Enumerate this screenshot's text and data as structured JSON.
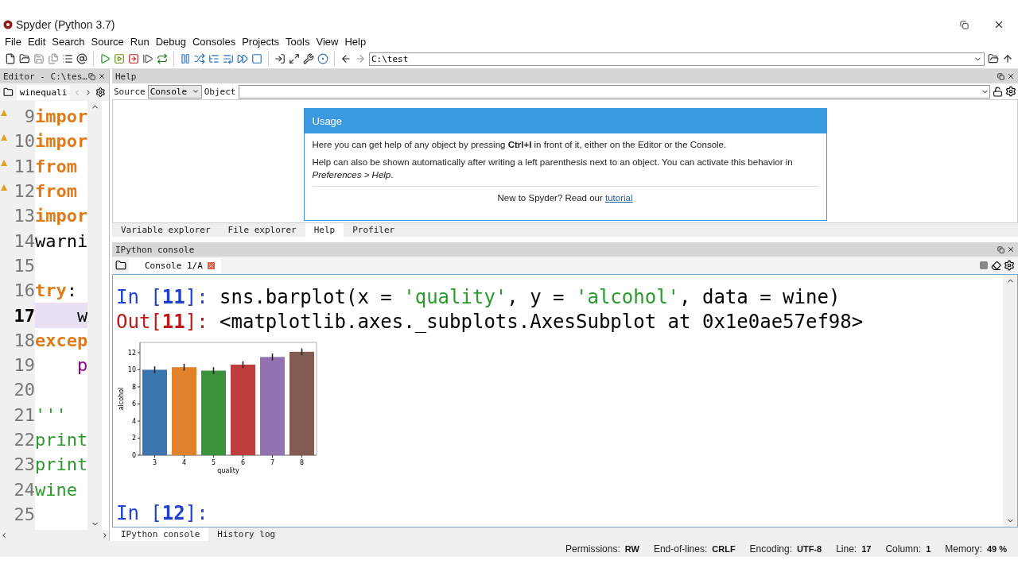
{
  "window": {
    "title": "Spyder (Python 3.7)"
  },
  "menu": [
    "File",
    "Edit",
    "Search",
    "Source",
    "Run",
    "Debug",
    "Consoles",
    "Projects",
    "Tools",
    "View",
    "Help"
  ],
  "toolbar": {
    "path": "C:\\test"
  },
  "editor": {
    "title": "Editor - C:\\tes…",
    "tab": "winequali",
    "lines": [
      {
        "number": "9",
        "warning": true,
        "current": false,
        "tokens": [
          {
            "text": "impor",
            "kind": "keyword"
          }
        ]
      },
      {
        "number": "10",
        "warning": true,
        "current": false,
        "tokens": [
          {
            "text": "impor",
            "kind": "keyword"
          }
        ]
      },
      {
        "number": "11",
        "warning": true,
        "current": false,
        "tokens": [
          {
            "text": "from",
            "kind": "keyword"
          }
        ]
      },
      {
        "number": "12",
        "warning": true,
        "current": false,
        "tokens": [
          {
            "text": "from",
            "kind": "keyword"
          }
        ]
      },
      {
        "number": "13",
        "warning": false,
        "current": false,
        "tokens": [
          {
            "text": "impor",
            "kind": "keyword"
          }
        ]
      },
      {
        "number": "14",
        "warning": false,
        "current": false,
        "tokens": [
          {
            "text": "warni",
            "kind": "plain"
          }
        ]
      },
      {
        "number": "15",
        "warning": false,
        "current": false
      },
      {
        "number": "16",
        "warning": false,
        "current": false,
        "tokens": [
          {
            "text": "try",
            "kind": "keyword"
          },
          {
            "text": ":",
            "kind": "plain"
          }
        ]
      },
      {
        "number": "17",
        "warning": false,
        "current": true,
        "tokens": [
          {
            "text": "    w",
            "kind": "plain"
          }
        ]
      },
      {
        "number": "18",
        "warning": false,
        "current": false,
        "tokens": [
          {
            "text": "excep",
            "kind": "keyword"
          }
        ]
      },
      {
        "number": "19",
        "warning": false,
        "current": false,
        "tokens": [
          {
            "text": "    p",
            "kind": "builtin"
          }
        ]
      },
      {
        "number": "20",
        "warning": false,
        "current": false
      },
      {
        "number": "21",
        "warning": false,
        "current": false,
        "tokens": [
          {
            "text": "'''",
            "kind": "string"
          }
        ]
      },
      {
        "number": "22",
        "warning": false,
        "current": false,
        "tokens": [
          {
            "text": "print",
            "kind": "string"
          }
        ]
      },
      {
        "number": "23",
        "warning": false,
        "current": false,
        "tokens": [
          {
            "text": "print",
            "kind": "string"
          }
        ]
      },
      {
        "number": "24",
        "warning": false,
        "current": false,
        "tokens": [
          {
            "text": "wine",
            "kind": "string"
          }
        ]
      },
      {
        "number": "25",
        "warning": false,
        "current": false
      }
    ]
  },
  "help": {
    "title": "Help",
    "source_label": "Source",
    "source_value": "Console",
    "object_label": "Object",
    "card": {
      "title": "Usage",
      "paragraphs": [
        "Here you can get help of any object by pressing **Ctrl+I** in front of it, either on the Editor or the Console.",
        "Help can also be shown automatically after writing a left parenthesis next to an object. You can activate this behavior in *Preferences > Help*."
      ],
      "footer": "New to Spyder? Read our ",
      "link": "tutorial"
    },
    "tabs": [
      {
        "label": "Variable explorer",
        "selected": false
      },
      {
        "label": "File explorer",
        "selected": false
      },
      {
        "label": "Help",
        "selected": true
      },
      {
        "label": "Profiler",
        "selected": false
      }
    ]
  },
  "console": {
    "title": "IPython console",
    "tab": "Console 1/A",
    "lines": [
      {
        "kind": "in",
        "prompt": "In [",
        "number": "11",
        "close": "]: ",
        "tokens": [
          {
            "text": "sns.barplot(x = ",
            "kind": "code"
          },
          {
            "text": "'quality'",
            "kind": "string"
          },
          {
            "text": ", y = ",
            "kind": "code"
          },
          {
            "text": "'alcohol'",
            "kind": "string"
          },
          {
            "text": ", data = wine)",
            "kind": "code"
          }
        ]
      },
      {
        "kind": "out",
        "prompt": "Out[",
        "number": "11",
        "close": "]: ",
        "tokens": [
          {
            "text": "<matplotlib.axes._subplots.AxesSubplot at 0x1e0ae57ef98>",
            "kind": "code"
          }
        ]
      }
    ],
    "chart_data": {
      "type": "bar",
      "xlabel": "quality",
      "ylabel": "alcohol",
      "categories": [
        "3",
        "4",
        "5",
        "6",
        "7",
        "8"
      ],
      "stacked": true,
      "series": [
        {
          "color": "#3a75b0",
          "values": [
            10.0,
            null,
            null,
            null,
            null,
            null
          ]
        },
        {
          "color": "#e1812c",
          "values": [
            null,
            10.3,
            null,
            null,
            null,
            null
          ]
        },
        {
          "color": "#3a923a",
          "values": [
            null,
            null,
            9.9,
            null,
            null,
            null
          ]
        },
        {
          "color": "#c03d3e",
          "values": [
            null,
            null,
            null,
            10.6,
            null,
            null
          ]
        },
        {
          "color": "#9372b2",
          "values": [
            null,
            null,
            null,
            null,
            11.5,
            null
          ]
        },
        {
          "color": "#845b53",
          "values": [
            null,
            null,
            null,
            null,
            null,
            12.1
          ]
        }
      ],
      "ylim": [
        0,
        13.2
      ],
      "yticks": [
        0,
        2,
        4,
        6,
        8,
        10,
        12
      ]
    },
    "prompt": {
      "prompt": "In [",
      "number": "12",
      "close": "]:"
    },
    "bottom_tabs": [
      {
        "label": "IPython console",
        "selected": true
      },
      {
        "label": "History log",
        "selected": false
      }
    ]
  },
  "status": [
    {
      "label": "Permissions:",
      "value": "RW"
    },
    {
      "label": "End-of-lines:",
      "value": "CRLF"
    },
    {
      "label": "Encoding:",
      "value": "UTF-8"
    },
    {
      "label": "Line:",
      "value": "17"
    },
    {
      "label": "Column:",
      "value": "1"
    },
    {
      "label": "Memory:",
      "value": "49 %"
    }
  ]
}
